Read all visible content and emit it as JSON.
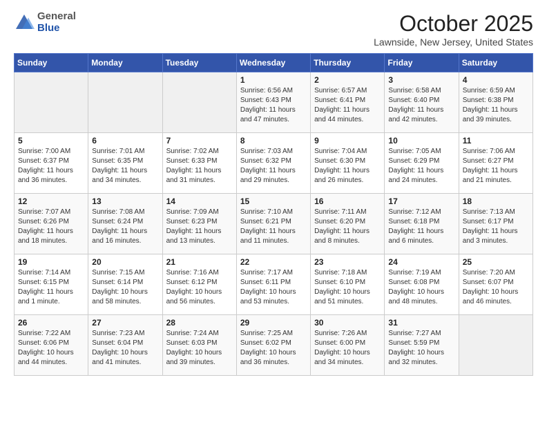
{
  "header": {
    "logo": {
      "general": "General",
      "blue": "Blue"
    },
    "title": "October 2025",
    "location": "Lawnside, New Jersey, United States"
  },
  "weekdays": [
    "Sunday",
    "Monday",
    "Tuesday",
    "Wednesday",
    "Thursday",
    "Friday",
    "Saturday"
  ],
  "weeks": [
    [
      {
        "day": "",
        "info": ""
      },
      {
        "day": "",
        "info": ""
      },
      {
        "day": "",
        "info": ""
      },
      {
        "day": "1",
        "info": "Sunrise: 6:56 AM\nSunset: 6:43 PM\nDaylight: 11 hours and 47 minutes."
      },
      {
        "day": "2",
        "info": "Sunrise: 6:57 AM\nSunset: 6:41 PM\nDaylight: 11 hours and 44 minutes."
      },
      {
        "day": "3",
        "info": "Sunrise: 6:58 AM\nSunset: 6:40 PM\nDaylight: 11 hours and 42 minutes."
      },
      {
        "day": "4",
        "info": "Sunrise: 6:59 AM\nSunset: 6:38 PM\nDaylight: 11 hours and 39 minutes."
      }
    ],
    [
      {
        "day": "5",
        "info": "Sunrise: 7:00 AM\nSunset: 6:37 PM\nDaylight: 11 hours and 36 minutes."
      },
      {
        "day": "6",
        "info": "Sunrise: 7:01 AM\nSunset: 6:35 PM\nDaylight: 11 hours and 34 minutes."
      },
      {
        "day": "7",
        "info": "Sunrise: 7:02 AM\nSunset: 6:33 PM\nDaylight: 11 hours and 31 minutes."
      },
      {
        "day": "8",
        "info": "Sunrise: 7:03 AM\nSunset: 6:32 PM\nDaylight: 11 hours and 29 minutes."
      },
      {
        "day": "9",
        "info": "Sunrise: 7:04 AM\nSunset: 6:30 PM\nDaylight: 11 hours and 26 minutes."
      },
      {
        "day": "10",
        "info": "Sunrise: 7:05 AM\nSunset: 6:29 PM\nDaylight: 11 hours and 24 minutes."
      },
      {
        "day": "11",
        "info": "Sunrise: 7:06 AM\nSunset: 6:27 PM\nDaylight: 11 hours and 21 minutes."
      }
    ],
    [
      {
        "day": "12",
        "info": "Sunrise: 7:07 AM\nSunset: 6:26 PM\nDaylight: 11 hours and 18 minutes."
      },
      {
        "day": "13",
        "info": "Sunrise: 7:08 AM\nSunset: 6:24 PM\nDaylight: 11 hours and 16 minutes."
      },
      {
        "day": "14",
        "info": "Sunrise: 7:09 AM\nSunset: 6:23 PM\nDaylight: 11 hours and 13 minutes."
      },
      {
        "day": "15",
        "info": "Sunrise: 7:10 AM\nSunset: 6:21 PM\nDaylight: 11 hours and 11 minutes."
      },
      {
        "day": "16",
        "info": "Sunrise: 7:11 AM\nSunset: 6:20 PM\nDaylight: 11 hours and 8 minutes."
      },
      {
        "day": "17",
        "info": "Sunrise: 7:12 AM\nSunset: 6:18 PM\nDaylight: 11 hours and 6 minutes."
      },
      {
        "day": "18",
        "info": "Sunrise: 7:13 AM\nSunset: 6:17 PM\nDaylight: 11 hours and 3 minutes."
      }
    ],
    [
      {
        "day": "19",
        "info": "Sunrise: 7:14 AM\nSunset: 6:15 PM\nDaylight: 11 hours and 1 minute."
      },
      {
        "day": "20",
        "info": "Sunrise: 7:15 AM\nSunset: 6:14 PM\nDaylight: 10 hours and 58 minutes."
      },
      {
        "day": "21",
        "info": "Sunrise: 7:16 AM\nSunset: 6:12 PM\nDaylight: 10 hours and 56 minutes."
      },
      {
        "day": "22",
        "info": "Sunrise: 7:17 AM\nSunset: 6:11 PM\nDaylight: 10 hours and 53 minutes."
      },
      {
        "day": "23",
        "info": "Sunrise: 7:18 AM\nSunset: 6:10 PM\nDaylight: 10 hours and 51 minutes."
      },
      {
        "day": "24",
        "info": "Sunrise: 7:19 AM\nSunset: 6:08 PM\nDaylight: 10 hours and 48 minutes."
      },
      {
        "day": "25",
        "info": "Sunrise: 7:20 AM\nSunset: 6:07 PM\nDaylight: 10 hours and 46 minutes."
      }
    ],
    [
      {
        "day": "26",
        "info": "Sunrise: 7:22 AM\nSunset: 6:06 PM\nDaylight: 10 hours and 44 minutes."
      },
      {
        "day": "27",
        "info": "Sunrise: 7:23 AM\nSunset: 6:04 PM\nDaylight: 10 hours and 41 minutes."
      },
      {
        "day": "28",
        "info": "Sunrise: 7:24 AM\nSunset: 6:03 PM\nDaylight: 10 hours and 39 minutes."
      },
      {
        "day": "29",
        "info": "Sunrise: 7:25 AM\nSunset: 6:02 PM\nDaylight: 10 hours and 36 minutes."
      },
      {
        "day": "30",
        "info": "Sunrise: 7:26 AM\nSunset: 6:00 PM\nDaylight: 10 hours and 34 minutes."
      },
      {
        "day": "31",
        "info": "Sunrise: 7:27 AM\nSunset: 5:59 PM\nDaylight: 10 hours and 32 minutes."
      },
      {
        "day": "",
        "info": ""
      }
    ]
  ]
}
